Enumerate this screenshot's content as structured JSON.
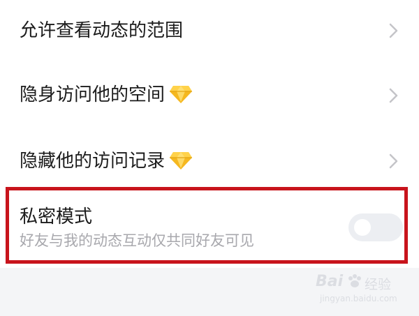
{
  "settings": {
    "items": [
      {
        "label": "允许查看动态的范围",
        "has_gem": false
      },
      {
        "label": "隐身访问他的空间",
        "has_gem": true
      },
      {
        "label": "隐藏他的访问记录",
        "has_gem": true
      }
    ],
    "private_mode": {
      "title": "私密模式",
      "description": "好友与我的动态互动仅共同好友可见",
      "enabled": false
    }
  },
  "icons": {
    "chevron": "chevron-right-icon",
    "gem": "diamond-vip-icon"
  },
  "watermark": {
    "brand": "Bai",
    "brand_suffix": "经验",
    "url": "jingyan.baidu.com"
  },
  "colors": {
    "highlight_border": "#c8141c",
    "gem_gold": "#f5b820",
    "toggle_off": "#eceef2"
  }
}
